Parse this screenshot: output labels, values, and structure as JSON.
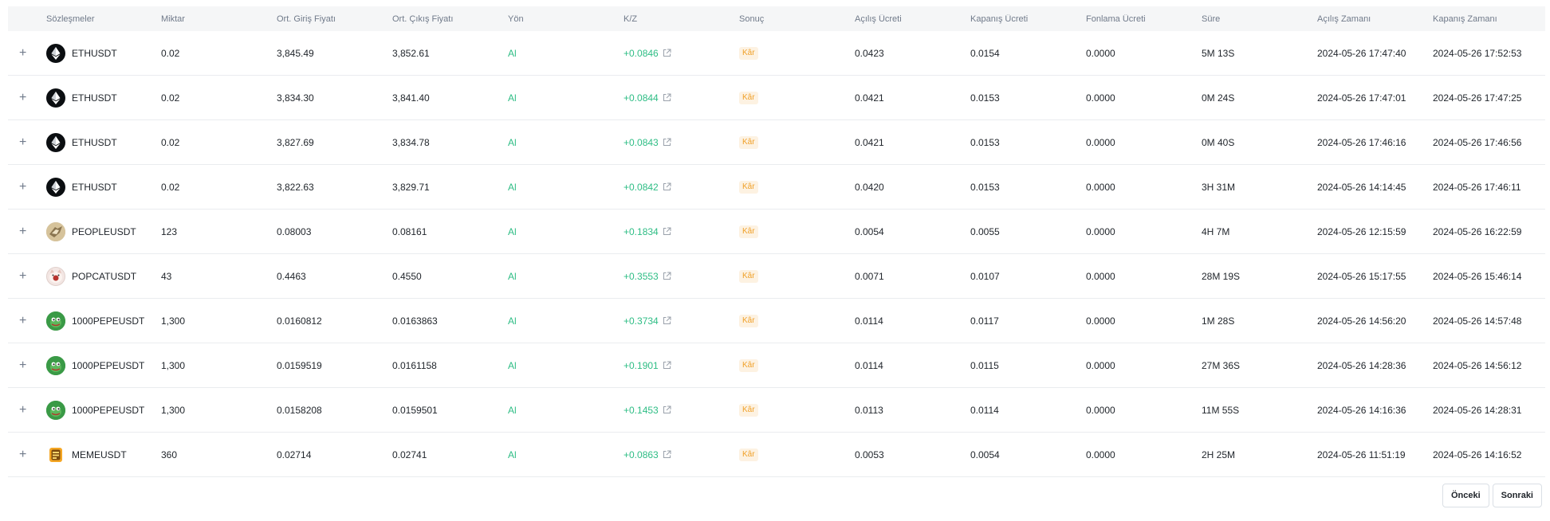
{
  "headers": {
    "contract": "Sözleşmeler",
    "amount": "Miktar",
    "avg_entry": "Ort. Giriş Fiyatı",
    "avg_exit": "Ort. Çıkış Fiyatı",
    "side": "Yön",
    "pnl": "K/Z",
    "result": "Sonuç",
    "open_fee": "Açılış Ücreti",
    "close_fee": "Kapanış Ücreti",
    "funding_fee": "Fonlama Ücreti",
    "duration": "Süre",
    "open_time": "Açılış Zamanı",
    "close_time": "Kapanış Zamanı"
  },
  "expand_symbol": "+",
  "rows": [
    {
      "symbol": "ETHUSDT",
      "icon": "eth-icon",
      "amount": "0.02",
      "entry": "3,845.49",
      "exit": "3,852.61",
      "side": "Al",
      "pnl": "+0.0846",
      "result": "Kâr",
      "open_fee": "0.0423",
      "close_fee": "0.0154",
      "funding": "0.0000",
      "duration": "5M 13S",
      "open_time": "2024-05-26 17:47:40",
      "close_time": "2024-05-26 17:52:53"
    },
    {
      "symbol": "ETHUSDT",
      "icon": "eth-icon",
      "amount": "0.02",
      "entry": "3,834.30",
      "exit": "3,841.40",
      "side": "Al",
      "pnl": "+0.0844",
      "result": "Kâr",
      "open_fee": "0.0421",
      "close_fee": "0.0153",
      "funding": "0.0000",
      "duration": "0M 24S",
      "open_time": "2024-05-26 17:47:01",
      "close_time": "2024-05-26 17:47:25"
    },
    {
      "symbol": "ETHUSDT",
      "icon": "eth-icon",
      "amount": "0.02",
      "entry": "3,827.69",
      "exit": "3,834.78",
      "side": "Al",
      "pnl": "+0.0843",
      "result": "Kâr",
      "open_fee": "0.0421",
      "close_fee": "0.0153",
      "funding": "0.0000",
      "duration": "0M 40S",
      "open_time": "2024-05-26 17:46:16",
      "close_time": "2024-05-26 17:46:56"
    },
    {
      "symbol": "ETHUSDT",
      "icon": "eth-icon",
      "amount": "0.02",
      "entry": "3,822.63",
      "exit": "3,829.71",
      "side": "Al",
      "pnl": "+0.0842",
      "result": "Kâr",
      "open_fee": "0.0420",
      "close_fee": "0.0153",
      "funding": "0.0000",
      "duration": "3H 31M",
      "open_time": "2024-05-26 14:14:45",
      "close_time": "2024-05-26 17:46:11"
    },
    {
      "symbol": "PEOPLEUSDT",
      "icon": "people-icon",
      "amount": "123",
      "entry": "0.08003",
      "exit": "0.08161",
      "side": "Al",
      "pnl": "+0.1834",
      "result": "Kâr",
      "open_fee": "0.0054",
      "close_fee": "0.0055",
      "funding": "0.0000",
      "duration": "4H 7M",
      "open_time": "2024-05-26 12:15:59",
      "close_time": "2024-05-26 16:22:59"
    },
    {
      "symbol": "POPCATUSDT",
      "icon": "popcat-icon",
      "amount": "43",
      "entry": "0.4463",
      "exit": "0.4550",
      "side": "Al",
      "pnl": "+0.3553",
      "result": "Kâr",
      "open_fee": "0.0071",
      "close_fee": "0.0107",
      "funding": "0.0000",
      "duration": "28M 19S",
      "open_time": "2024-05-26 15:17:55",
      "close_time": "2024-05-26 15:46:14"
    },
    {
      "symbol": "1000PEPEUSDT",
      "icon": "pepe-icon",
      "amount": "1,300",
      "entry": "0.0160812",
      "exit": "0.0163863",
      "side": "Al",
      "pnl": "+0.3734",
      "result": "Kâr",
      "open_fee": "0.0114",
      "close_fee": "0.0117",
      "funding": "0.0000",
      "duration": "1M 28S",
      "open_time": "2024-05-26 14:56:20",
      "close_time": "2024-05-26 14:57:48"
    },
    {
      "symbol": "1000PEPEUSDT",
      "icon": "pepe-icon",
      "amount": "1,300",
      "entry": "0.0159519",
      "exit": "0.0161158",
      "side": "Al",
      "pnl": "+0.1901",
      "result": "Kâr",
      "open_fee": "0.0114",
      "close_fee": "0.0115",
      "funding": "0.0000",
      "duration": "27M 36S",
      "open_time": "2024-05-26 14:28:36",
      "close_time": "2024-05-26 14:56:12"
    },
    {
      "symbol": "1000PEPEUSDT",
      "icon": "pepe-icon",
      "amount": "1,300",
      "entry": "0.0158208",
      "exit": "0.0159501",
      "side": "Al",
      "pnl": "+0.1453",
      "result": "Kâr",
      "open_fee": "0.0113",
      "close_fee": "0.0114",
      "funding": "0.0000",
      "duration": "11M 55S",
      "open_time": "2024-05-26 14:16:36",
      "close_time": "2024-05-26 14:28:31"
    },
    {
      "symbol": "MEMEUSDT",
      "icon": "meme-icon",
      "amount": "360",
      "entry": "0.02714",
      "exit": "0.02741",
      "side": "Al",
      "pnl": "+0.0863",
      "result": "Kâr",
      "open_fee": "0.0053",
      "close_fee": "0.0054",
      "funding": "0.0000",
      "duration": "2H 25M",
      "open_time": "2024-05-26 11:51:19",
      "close_time": "2024-05-26 14:16:52"
    }
  ],
  "pagination": {
    "prev_label": "Önceki",
    "next_label": "Sonraki"
  },
  "colors": {
    "profit": "#2ebd85",
    "badge_text": "#f0a12a",
    "badge_bg": "#fdf2e2",
    "header_bg": "#f5f6f7"
  }
}
